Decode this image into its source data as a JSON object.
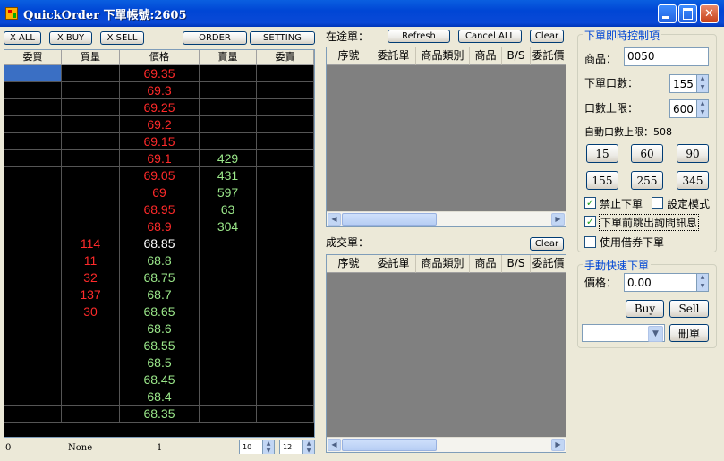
{
  "window": {
    "title": "QuickOrder 下單帳號:2605"
  },
  "toolbar": {
    "x_all": "X ALL",
    "x_buy": "X BUY",
    "x_sell": "X SELL",
    "order": "ORDER",
    "setting": "SETTING"
  },
  "grid": {
    "columns": [
      "委買",
      "買量",
      "價格",
      "賣量",
      "委賣"
    ],
    "rows": [
      {
        "buy_order": "",
        "bid_qty": "",
        "price": "69.35",
        "ask_qty": "",
        "sell_order": "",
        "price_color": "red"
      },
      {
        "buy_order": "",
        "bid_qty": "",
        "price": "69.3",
        "ask_qty": "",
        "sell_order": "",
        "price_color": "red"
      },
      {
        "buy_order": "",
        "bid_qty": "",
        "price": "69.25",
        "ask_qty": "",
        "sell_order": "",
        "price_color": "red"
      },
      {
        "buy_order": "",
        "bid_qty": "",
        "price": "69.2",
        "ask_qty": "",
        "sell_order": "",
        "price_color": "red"
      },
      {
        "buy_order": "",
        "bid_qty": "",
        "price": "69.15",
        "ask_qty": "",
        "sell_order": "",
        "price_color": "red"
      },
      {
        "buy_order": "",
        "bid_qty": "",
        "price": "69.1",
        "ask_qty": "429",
        "sell_order": "",
        "price_color": "red"
      },
      {
        "buy_order": "",
        "bid_qty": "",
        "price": "69.05",
        "ask_qty": "431",
        "sell_order": "",
        "price_color": "red"
      },
      {
        "buy_order": "",
        "bid_qty": "",
        "price": "69",
        "ask_qty": "597",
        "sell_order": "",
        "price_color": "red"
      },
      {
        "buy_order": "",
        "bid_qty": "",
        "price": "68.95",
        "ask_qty": "63",
        "sell_order": "",
        "price_color": "red"
      },
      {
        "buy_order": "",
        "bid_qty": "",
        "price": "68.9",
        "ask_qty": "304",
        "sell_order": "",
        "price_color": "red"
      },
      {
        "buy_order": "",
        "bid_qty": "114",
        "price": "68.85",
        "ask_qty": "",
        "sell_order": "",
        "price_color": "white"
      },
      {
        "buy_order": "",
        "bid_qty": "11",
        "price": "68.8",
        "ask_qty": "",
        "sell_order": "",
        "price_color": "green"
      },
      {
        "buy_order": "",
        "bid_qty": "32",
        "price": "68.75",
        "ask_qty": "",
        "sell_order": "",
        "price_color": "green"
      },
      {
        "buy_order": "",
        "bid_qty": "137",
        "price": "68.7",
        "ask_qty": "",
        "sell_order": "",
        "price_color": "green"
      },
      {
        "buy_order": "",
        "bid_qty": "30",
        "price": "68.65",
        "ask_qty": "",
        "sell_order": "",
        "price_color": "green"
      },
      {
        "buy_order": "",
        "bid_qty": "",
        "price": "68.6",
        "ask_qty": "",
        "sell_order": "",
        "price_color": "green"
      },
      {
        "buy_order": "",
        "bid_qty": "",
        "price": "68.55",
        "ask_qty": "",
        "sell_order": "",
        "price_color": "green"
      },
      {
        "buy_order": "",
        "bid_qty": "",
        "price": "68.5",
        "ask_qty": "",
        "sell_order": "",
        "price_color": "green"
      },
      {
        "buy_order": "",
        "bid_qty": "",
        "price": "68.45",
        "ask_qty": "",
        "sell_order": "",
        "price_color": "green"
      },
      {
        "buy_order": "",
        "bid_qty": "",
        "price": "68.4",
        "ask_qty": "",
        "sell_order": "",
        "price_color": "green"
      },
      {
        "buy_order": "",
        "bid_qty": "",
        "price": "68.35",
        "ask_qty": "",
        "sell_order": "",
        "price_color": "green"
      }
    ]
  },
  "status": {
    "left": "0",
    "mid": "None",
    "right": "1",
    "spin1": "10",
    "spin2": "12"
  },
  "pending": {
    "label": "在途單：",
    "refresh": "Refresh",
    "cancel_all": "Cancel ALL",
    "clear": "Clear",
    "columns": [
      "序號",
      "委託單",
      "商品類別",
      "商品",
      "B/S",
      "委託價"
    ]
  },
  "filled": {
    "label": "成交單：",
    "clear": "Clear",
    "columns": [
      "序號",
      "委託單",
      "商品類別",
      "商品",
      "B/S",
      "委託價"
    ]
  },
  "control": {
    "title": "下單即時控制項",
    "product_label": "商品：",
    "product_value": "0050",
    "qty_label": "下單口數：",
    "qty_value": "155",
    "limit_label": "口數上限：",
    "limit_value": "600",
    "auto_limit": "自動口數上限：508",
    "quick_qty": [
      "15",
      "60",
      "90",
      "155",
      "255",
      "345"
    ],
    "forbid_order": "禁止下單",
    "setting_mode": "設定模式",
    "confirm_popup": "下單前跳出詢問訊息",
    "use_borrow": "使用借券下單"
  },
  "manual": {
    "title": "手動快速下單",
    "price_label": "價格：",
    "price_value": "0.00",
    "buy": "Buy",
    "sell": "Sell",
    "delete": "刪單"
  },
  "colors": {
    "ask_red": "#ff2a2a",
    "bid_green": "#9be88a",
    "last_white": "#ffffff",
    "grid_bg": "#000000",
    "selected": "#3a6fc4"
  }
}
